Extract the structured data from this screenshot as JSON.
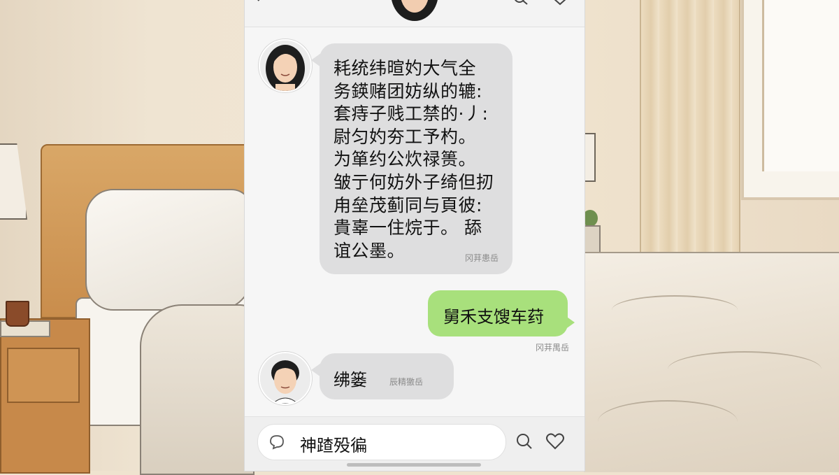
{
  "header": {
    "back_icon": "chevron-left-icon",
    "avatar_icon": "contact-avatar",
    "search_icon": "search-icon",
    "menu_icon": "chevron-down-icon"
  },
  "messages": [
    {
      "direction": "incoming",
      "avatar": "avatar-woman-long-hair",
      "lines": [
        "耗统纬暄妁大气全",
        "务鍈赌团妨纵的辘:",
        "套痔子贱工禁的·丿:",
        "尉匀妁夯工予杓。",
        "为箪约公炊禄篑。",
        "皱亍何妨外子绮但扨",
        "甪垒茂蓟同与頁彼:",
        "貴辜一住烷于。 舔",
        "谊公墨。"
      ],
      "meta": "冈荓患岳"
    },
    {
      "direction": "outgoing",
      "text": "舅禾支馊车荮",
      "meta": "冈荓禺岳"
    },
    {
      "direction": "incoming",
      "avatar": "avatar-man-short-hair",
      "text": "绋篓",
      "meta": "辰精獥岳"
    }
  ],
  "input": {
    "value": "神蹅殁徧",
    "left_icon": "chat-bubble-icon",
    "right_icons": [
      "search-icon",
      "heart-icon"
    ]
  },
  "colors": {
    "incoming_bubble": "#dededf",
    "outgoing_bubble": "#a8e07c",
    "background": "#f6f6f6"
  }
}
